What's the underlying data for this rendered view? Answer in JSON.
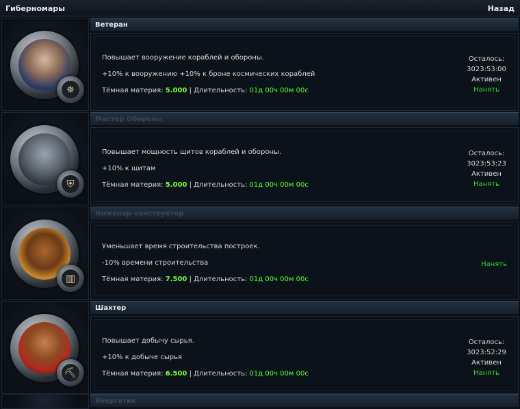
{
  "topbar": {
    "title": "Гиберномары",
    "back_label": "Назад"
  },
  "officers": [
    {
      "name": "Ветеран",
      "description": "Повышает вооружение кораблей и обороны.",
      "bonus": "+10% к вооружению +10% к броне космических кораблей",
      "dm_label": "Тёмная материя:",
      "dm_value": "5.000",
      "sep": "|",
      "duration_label": "Длительность:",
      "duration_value": "01д 00ч 00м 00с",
      "status_remaining_label": "Осталось:",
      "status_time": "3023:53:00",
      "status_state": "Активен",
      "hire_label": "Нанять",
      "badge_icon": "compass-star-icon"
    },
    {
      "name": "Мастер Обороны",
      "description": "Повышает мощность щитов кораблей и обороны.",
      "bonus": "+10% к щитам",
      "dm_label": "Тёмная материя:",
      "dm_value": "5.000",
      "sep": "|",
      "duration_label": "Длительность:",
      "duration_value": "01д 00ч 00м 00с",
      "status_remaining_label": "Осталось:",
      "status_time": "3023:53:23",
      "status_state": "Активен",
      "hire_label": "Нанять",
      "badge_icon": "shield-icon"
    },
    {
      "name": "Инженер-конструктор",
      "description": "Уменьшает время строительства построек.",
      "bonus": "-10% времени строительства",
      "dm_label": "Тёмная материя:",
      "dm_value": "7.500",
      "sep": "|",
      "duration_label": "Длительность:",
      "duration_value": "01д 00ч 00м 00с",
      "hire_label": "Нанять",
      "badge_icon": "buildings-icon"
    },
    {
      "name": "Шахтер",
      "description": "Повышает добычу сырья.",
      "bonus": "+10% к добыче сырья",
      "dm_label": "Тёмная материя:",
      "dm_value": "6.500",
      "sep": "|",
      "duration_label": "Длительность:",
      "duration_value": "01д 00ч 00м 00с",
      "status_remaining_label": "Осталось:",
      "status_time": "3023:52:29",
      "status_state": "Активен",
      "hire_label": "Нанять",
      "badge_icon": "pickaxe-icon"
    },
    {
      "name": "Энергетик"
    }
  ],
  "colors": {
    "accent_green": "#2ed82e",
    "dm_green": "#7fff3a",
    "header_bg": "#223041"
  }
}
